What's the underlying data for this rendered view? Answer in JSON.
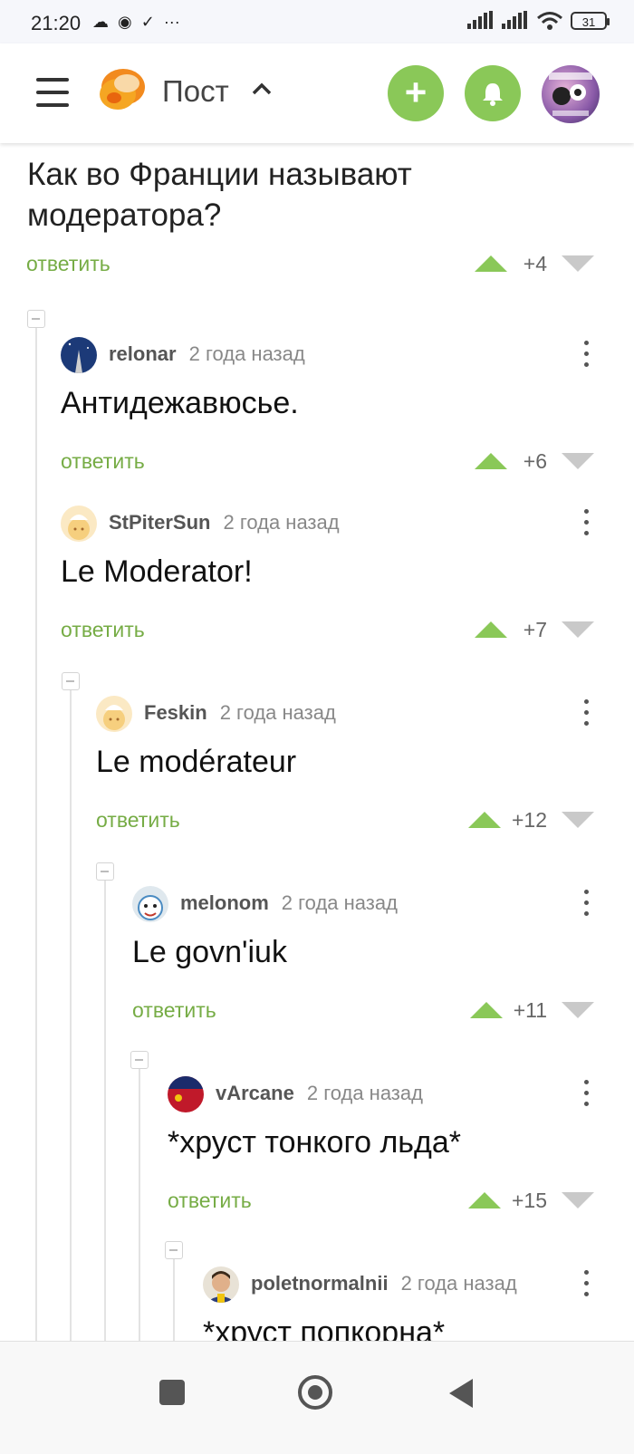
{
  "status_bar": {
    "time": "21:20",
    "battery": "31"
  },
  "header": {
    "title": "Пост",
    "plus_label": "+"
  },
  "post": {
    "question": "Как во Франции называют модератора?",
    "reply_label": "ответить",
    "score": "+4"
  },
  "comments": [
    {
      "user": "relonar",
      "time": "2 года назад",
      "text": "Антидежавюсье.",
      "reply_label": "ответить",
      "score": "+6"
    },
    {
      "user": "StPiterSun",
      "time": "2 года назад",
      "text": "Le Moderator!",
      "reply_label": "ответить",
      "score": "+7"
    },
    {
      "user": "Feskin",
      "time": "2 года назад",
      "text": "Le modérateur",
      "reply_label": "ответить",
      "score": "+12"
    },
    {
      "user": "melonom",
      "time": "2 года назад",
      "text": "Le govn'iuk",
      "reply_label": "ответить",
      "score": "+11"
    },
    {
      "user": "vArcane",
      "time": "2 года назад",
      "text": "*хруст тонкого льда*",
      "reply_label": "ответить",
      "score": "+15"
    },
    {
      "user": "poletnormalnii",
      "time": "2 года назад",
      "text": "*хруст попкорна*"
    }
  ],
  "colors": {
    "accent": "#8ac858",
    "reply": "#76ac45",
    "downvote": "#c9c9c9"
  }
}
